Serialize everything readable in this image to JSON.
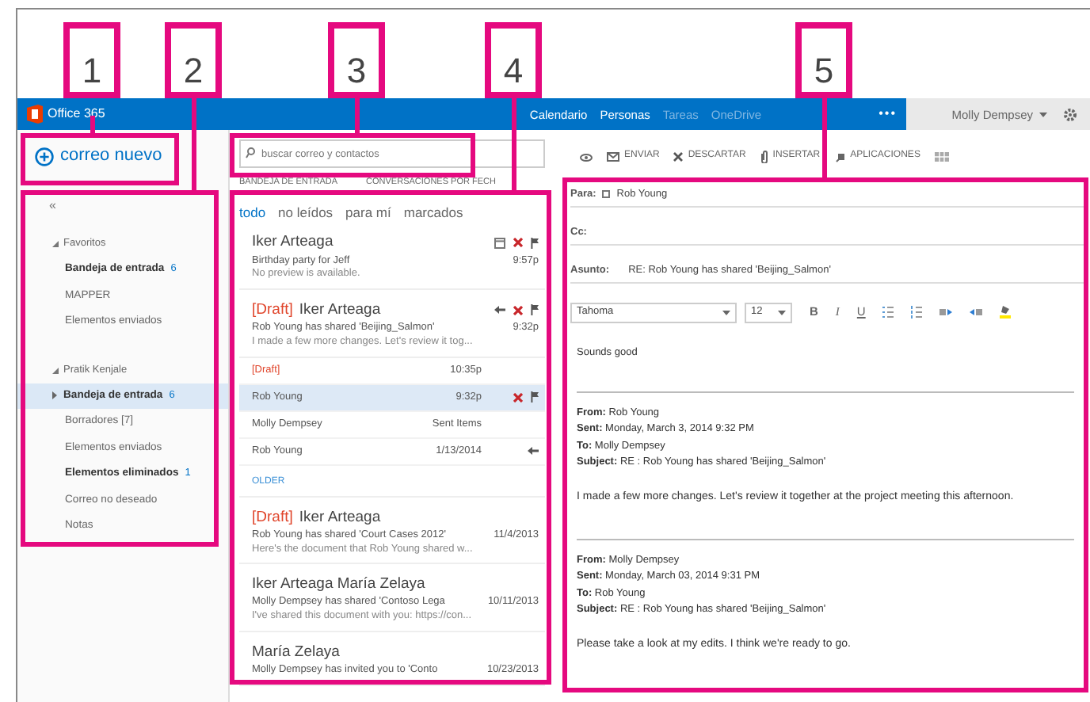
{
  "top_bar": {
    "app_name": "Office 365",
    "nav": [
      {
        "label": "Calendario",
        "dimmed": false
      },
      {
        "label": "Personas",
        "dimmed": false
      },
      {
        "label": "Tareas",
        "dimmed": true
      },
      {
        "label": "OneDrive",
        "dimmed": true
      }
    ],
    "more": "•••",
    "user": "Molly Dempsey"
  },
  "new_mail": "correo nuevo",
  "folders": {
    "collapse": "«",
    "groups": [
      {
        "name": "Favoritos",
        "expanded": true,
        "items": [
          {
            "label": "Bandeja de entrada",
            "count": "6",
            "unread": true,
            "selected": false
          },
          {
            "label": "MAPPER",
            "unread": false,
            "selected": false
          },
          {
            "label": "Elementos enviados",
            "unread": false,
            "selected": false
          }
        ]
      },
      {
        "name": "Pratik Kenjale",
        "expanded": true,
        "items": [
          {
            "label": "Bandeja de entrada",
            "count": "6",
            "unread": true,
            "selected": true,
            "has_subfolders": true
          },
          {
            "label": "Borradores [7]",
            "unread": false,
            "selected": false
          },
          {
            "label": "Elementos enviados",
            "unread": false,
            "selected": false
          },
          {
            "label": "Elementos eliminados",
            "count": "1",
            "unread": true,
            "selected": false
          },
          {
            "label": "Correo no deseado",
            "unread": false,
            "selected": false
          },
          {
            "label": "Notas",
            "unread": false,
            "selected": false
          }
        ]
      }
    ]
  },
  "message_list": {
    "search": {
      "placeholder": "buscar correo y contactos"
    },
    "header": "BANDEJA DE ENTRADA",
    "sort": "CONVERSACIONES POR FECH",
    "filters": [
      {
        "label": "todo",
        "selected": true
      },
      {
        "label": "no leídos",
        "selected": false
      },
      {
        "label": "para mí",
        "selected": false
      },
      {
        "label": "marcados",
        "selected": false
      }
    ],
    "items": [
      {
        "kind": "conversation",
        "sender": "Iker Arteaga",
        "subject": "Birthday party for Jeff",
        "preview": "No preview is available.",
        "time": "9:57p",
        "has_meeting": true,
        "replied": false,
        "actions_shown": true,
        "selected": false
      },
      {
        "kind": "conversation",
        "draft": "[Draft]",
        "sender": "Iker Arteaga",
        "subject": "Rob Young has shared 'Beijing_Salmon'",
        "preview": "I made a few more changes. Let's review it tog...",
        "time": "9:32p",
        "has_meeting": false,
        "replied": true,
        "actions_shown": true,
        "selected": false
      },
      {
        "kind": "message",
        "draft": "[Draft]",
        "time": "10:35p",
        "replied": false,
        "actions_shown": false,
        "selected": false
      },
      {
        "kind": "message",
        "sender": "Rob Young",
        "time": "9:32p",
        "replied": false,
        "actions_shown": true,
        "selected": true
      },
      {
        "kind": "message",
        "sender": "Molly Dempsey",
        "time": "Sent Items",
        "replied": false,
        "actions_shown": false,
        "selected": false
      },
      {
        "kind": "message",
        "sender": "Rob Young",
        "time": "1/13/2014",
        "replied": true,
        "actions_shown": false,
        "selected": false
      },
      {
        "kind": "section",
        "label": "OLDER"
      },
      {
        "kind": "conversation",
        "draft": "[Draft]",
        "sender": "Iker Arteaga",
        "subject": "Rob Young has shared 'Court Cases 2012'",
        "preview": "Here's the document that Rob Young shared w...",
        "time": "11/4/2013",
        "has_meeting": false,
        "replied": false,
        "actions_shown": false,
        "selected": false
      },
      {
        "kind": "conversation",
        "sender": "Iker Arteaga María Zelaya",
        "subject": "Molly Dempsey has shared 'Contoso Lega",
        "preview": "I've shared this document with you: https://con...",
        "time": "10/11/2013",
        "has_meeting": false,
        "replied": false,
        "actions_shown": false,
        "selected": false
      },
      {
        "kind": "conversation",
        "sender": "María Zelaya",
        "subject": "Molly Dempsey has invited you to 'Conto",
        "time": "10/23/2013",
        "has_meeting": false,
        "replied": false,
        "actions_shown": false,
        "selected": false
      }
    ]
  },
  "compose": {
    "toolbar": [
      {
        "kind": "view"
      },
      {
        "kind": "send",
        "label": "ENVIAR"
      },
      {
        "kind": "discard",
        "label": "DESCARTAR"
      },
      {
        "kind": "insert",
        "label": "INSERTAR"
      },
      {
        "kind": "apps",
        "label": "APLICACIONES"
      },
      {
        "kind": "more"
      }
    ],
    "to_label": "Para:",
    "to": "Rob Young",
    "cc_label": "Cc:",
    "subject_label": "Asunto:",
    "subject": "RE: Rob Young has shared 'Beijing_Salmon'",
    "font": "Tahoma",
    "size": "12",
    "format_buttons": [
      {
        "kind": "bold",
        "label": "B"
      },
      {
        "kind": "italic",
        "label": "I"
      },
      {
        "kind": "underline",
        "label": "U"
      },
      {
        "kind": "bullets"
      },
      {
        "kind": "numbering"
      },
      {
        "kind": "indent"
      },
      {
        "kind": "outdent"
      },
      {
        "kind": "highlight"
      }
    ],
    "reply": "Sounds good",
    "quoted": [
      {
        "headers": [
          "**From:** Rob Young",
          "**Sent:** Monday, March 3, 2014 9:32 PM",
          "**To:** Molly Dempsey",
          "**Subject:** RE : Rob Young has shared 'Beijing_Salmon'"
        ],
        "text": "I made a few more changes. Let's review it together at the project meeting this afternoon."
      },
      {
        "headers": [
          "**From:** Molly Dempsey",
          "**Sent:** Monday, March 03, 2014 9:31 PM",
          "**To:** Rob Young",
          "**Subject:** RE : Rob Young has shared 'Beijing_Salmon'"
        ],
        "text": "Please take a look at my edits. I think we're ready to go."
      }
    ]
  },
  "callouts": [
    {
      "label": "1"
    },
    {
      "label": "2"
    },
    {
      "label": "3"
    },
    {
      "label": "4"
    },
    {
      "label": "5"
    }
  ]
}
